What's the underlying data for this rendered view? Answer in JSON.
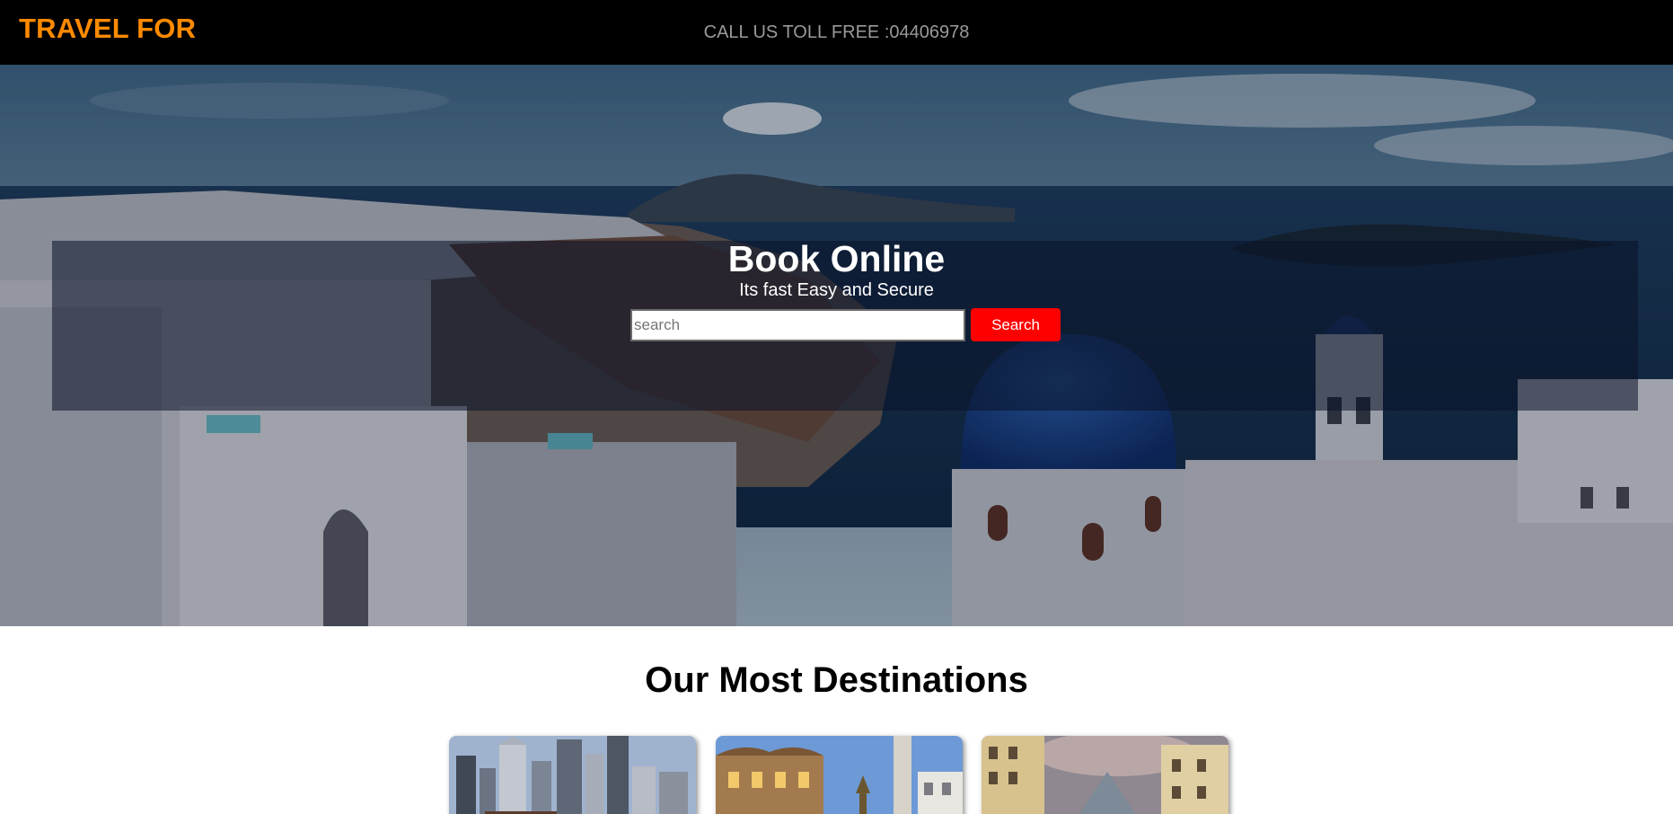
{
  "header": {
    "brand": "TRAVEL FOR",
    "tollfree": "CALL US TOLL FREE :04406978"
  },
  "hero": {
    "title": "Book Online",
    "subtitle": "Its fast Easy and Secure",
    "search_placeholder": "search",
    "search_button": "Search"
  },
  "destinations": {
    "title": "Our Most Destinations",
    "cards": [
      {
        "image": "city-skyline-photo"
      },
      {
        "image": "london-street-photo"
      },
      {
        "image": "old-town-square-photo"
      }
    ]
  },
  "colors": {
    "brand": "#ff8a00",
    "header_bg": "#000000",
    "search_button_bg": "#ff0000"
  }
}
